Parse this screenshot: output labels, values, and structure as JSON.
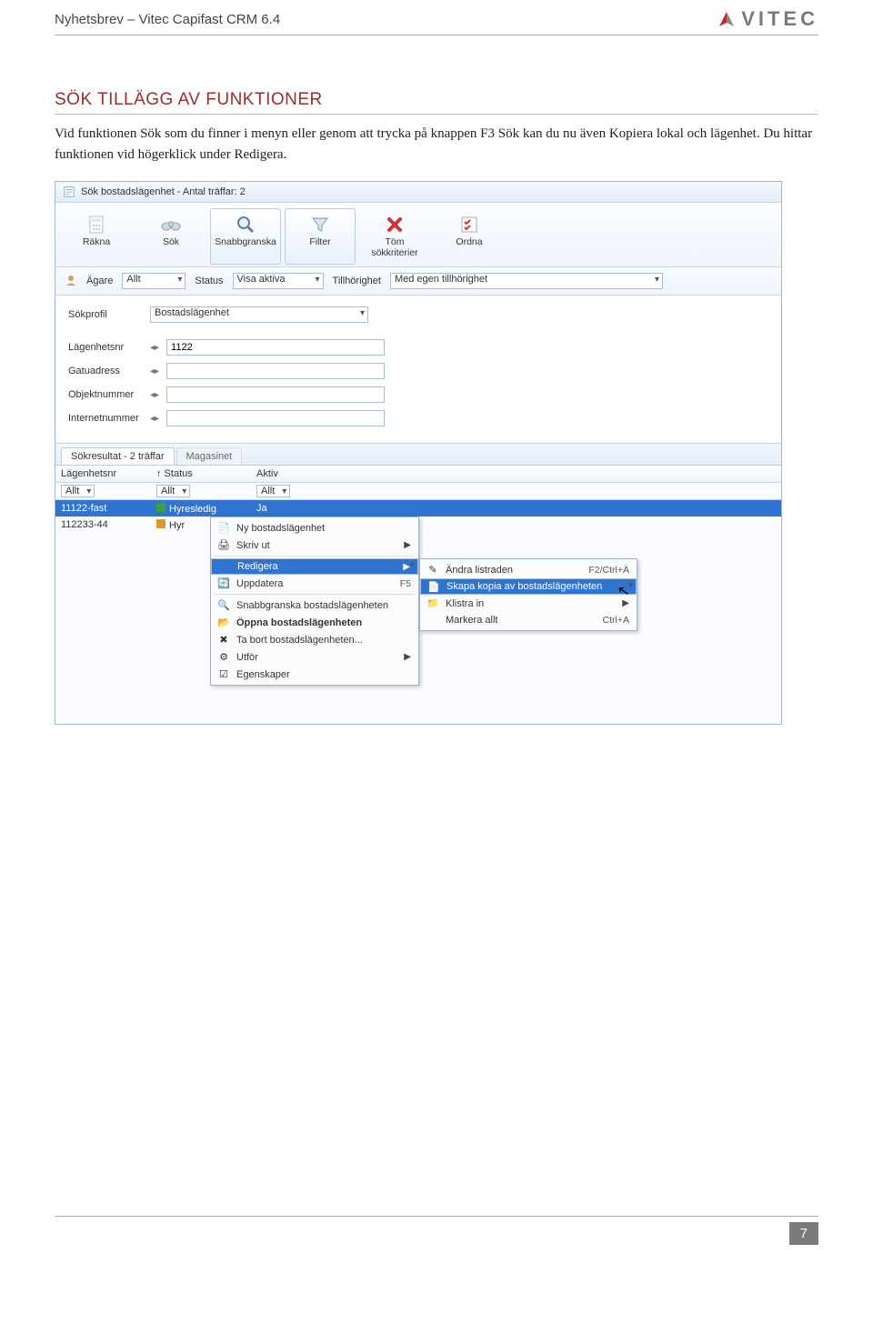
{
  "doc": {
    "header": "Nyhetsbrev – Vitec Capifast CRM 6.4",
    "brand": "VITEC",
    "page_number": "7"
  },
  "section": {
    "title": "SÖK TILLÄGG AV FUNKTIONER",
    "body": "Vid funktionen Sök som du finner i menyn eller genom att trycka på knappen F3 Sök kan du nu även Kopiera lokal och lägenhet. Du hittar funktionen vid högerklick under Redigera."
  },
  "app": {
    "title": "Sök bostadslägenhet - Antal träffar: 2",
    "toolbar": [
      {
        "label": "Räkna",
        "active": false
      },
      {
        "label": "Sök",
        "active": false
      },
      {
        "label": "Snabbgranska",
        "active": true
      },
      {
        "label": "Filter",
        "active": true
      },
      {
        "label": "Töm sökkriterier",
        "active": false
      },
      {
        "label": "Ordna",
        "active": false
      }
    ],
    "filters": {
      "owner_label": "Ägare",
      "owner_value": "Allt",
      "status_label": "Status",
      "status_value": "Visa aktiva",
      "belong_label": "Tillhörighet",
      "belong_value": "Med egen tillhörighet"
    },
    "form": {
      "profile_label": "Sökprofil",
      "profile_value": "Bostadslägenhet",
      "rows": [
        {
          "label": "Lägenhetsnr",
          "value": "1122"
        },
        {
          "label": "Gatuadress",
          "value": ""
        },
        {
          "label": "Objektnummer",
          "value": ""
        },
        {
          "label": "Internetnummer",
          "value": ""
        }
      ]
    },
    "tabs": {
      "active": "Sökresultat - 2 träffar",
      "inactive": "Magasinet"
    },
    "grid": {
      "headers": {
        "c1": "Lägenhetsnr",
        "c2": "↑ Status",
        "c3": "Aktiv"
      },
      "filters": {
        "c1": "Allt",
        "c2": "Allt",
        "c3": "Allt"
      },
      "rows": [
        {
          "c1": "11122-fast",
          "c2": "Hyresledig",
          "c3": "Ja",
          "selected": true,
          "color": "green"
        },
        {
          "c1": "112233-44",
          "c2": "Hyr",
          "c3": "",
          "selected": false,
          "color": "orange"
        }
      ]
    },
    "ctx1": [
      {
        "icon": "📄",
        "text": "Ny bostadslägenhet",
        "hot": "",
        "arrow": false
      },
      {
        "icon": "🖨",
        "text": "Skriv ut",
        "hot": "",
        "arrow": true
      },
      {
        "sep": true
      },
      {
        "icon": "",
        "text": "Redigera",
        "hot": "",
        "arrow": true,
        "selected": true
      },
      {
        "icon": "🔄",
        "text": "Uppdatera",
        "hot": "F5",
        "arrow": false
      },
      {
        "sep": true
      },
      {
        "icon": "🔍",
        "text": "Snabbgranska bostadslägenheten",
        "hot": "",
        "arrow": false
      },
      {
        "icon": "📂",
        "text": "Öppna bostadslägenheten",
        "hot": "",
        "arrow": false,
        "bold": true
      },
      {
        "icon": "✖",
        "text": "Ta bort bostadslägenheten...",
        "hot": "",
        "arrow": false
      },
      {
        "icon": "⚙",
        "text": "Utför",
        "hot": "",
        "arrow": true
      },
      {
        "icon": "☑",
        "text": "Egenskaper",
        "hot": "",
        "arrow": false
      }
    ],
    "ctx2": [
      {
        "icon": "✎",
        "text": "Ändra listraden",
        "hot": "F2/Ctrl+Ä"
      },
      {
        "icon": "📄",
        "text": "Skapa kopia av bostadslägenheten",
        "hot": "",
        "selected": true
      },
      {
        "icon": "📁",
        "text": "Klistra in",
        "hot": "",
        "arrow": true
      },
      {
        "icon": "",
        "text": "Markera allt",
        "hot": "Ctrl+A"
      }
    ]
  }
}
